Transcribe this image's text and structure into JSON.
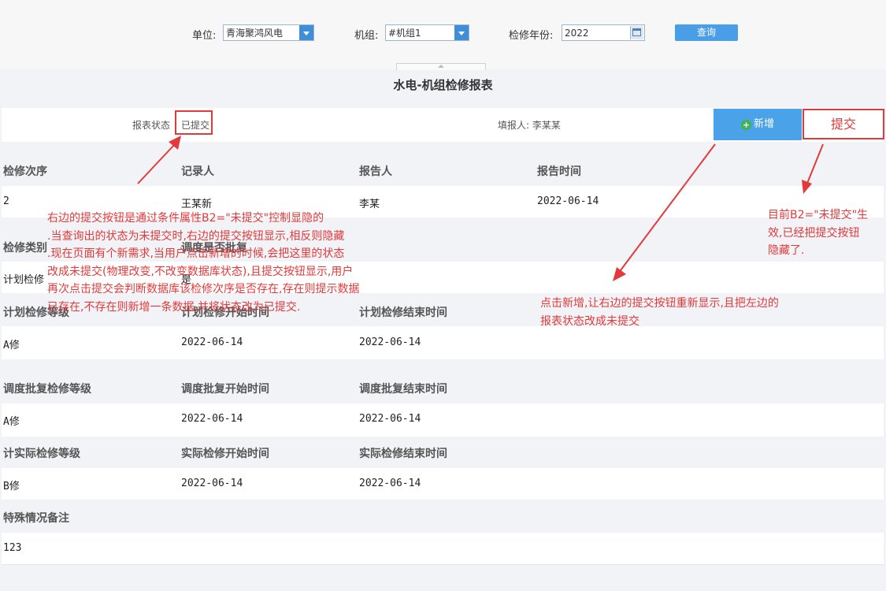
{
  "filters": {
    "unit_label": "单位:",
    "unit_value": "青海聚鸿风电",
    "unit_label_field": "机组:",
    "unit_no_value": "#机组1",
    "year_label": "检修年份:",
    "year_value": "2022",
    "query_label": "查询"
  },
  "report": {
    "title": "水电-机组检修报表",
    "status_label": "报表状态",
    "status_value": "已提交",
    "filler": "填报人: 李某某",
    "add_label": "新增",
    "submit_label": "提交"
  },
  "rows": [
    {
      "headers": [
        "检修次序",
        "记录人",
        "报告人",
        "报告时间"
      ],
      "values": [
        "2",
        "王某新",
        "李某",
        "2022-06-14"
      ]
    },
    {
      "headers": [
        "检修类别",
        "调度是否批复",
        "",
        ""
      ],
      "values": [
        "计划检修",
        "是",
        "",
        ""
      ]
    },
    {
      "headers": [
        "计划检修等级",
        "计划检修开始时间",
        "计划检修结束时间",
        ""
      ],
      "values": [
        "A修",
        "2022-06-14",
        "2022-06-14",
        ""
      ]
    },
    {
      "headers": [
        "调度批复检修等级",
        "调度批复开始时间",
        "调度批复结束时间",
        ""
      ],
      "values": [
        "A修",
        "2022-06-14",
        "2022-06-14",
        ""
      ]
    },
    {
      "headers": [
        "计实际检修等级",
        "实际检修开始时间",
        "实际检修结束时间",
        ""
      ],
      "values": [
        "B修",
        "2022-06-14",
        "2022-06-14",
        ""
      ]
    },
    {
      "headers": [
        "特殊情况备注",
        "",
        "",
        ""
      ],
      "values": [
        "123",
        "",
        "",
        ""
      ]
    }
  ],
  "annotations": {
    "left_note": [
      "右边的提交按钮是通过条件属性B2=\"未提交\"控制显隐的",
      ".当查询出的状态为未提交时,右边的提交按钮显示,相反则隐藏",
      ".现在页面有个新需求,当用户点击新增的时候,会把这里的状态",
      "改成未提交(物理改变,不改变数据库状态),且提交按钮显示,用户",
      "再次点击提交会判断数据库该检修次序是否存在,存在则提示数据",
      "已存在,不存在则新增一条数据,并将状态改为已提交."
    ],
    "middle_note": [
      "点击新增,让右边的提交按钮重新显示,且把左边的",
      "报表状态改成未提交"
    ],
    "right_note": [
      "目前B2=\"未提交\"生",
      "效,已经把提交按钮",
      "隐藏了."
    ]
  }
}
